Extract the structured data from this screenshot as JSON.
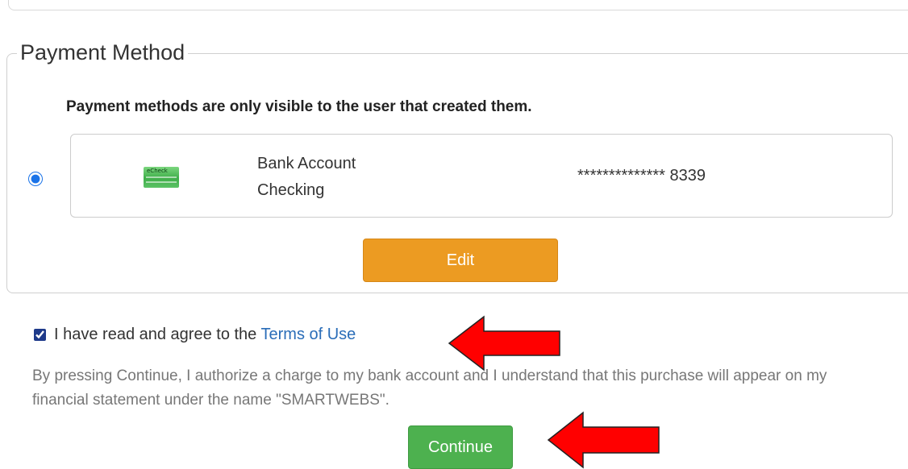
{
  "payment_method": {
    "legend": "Payment Method",
    "notice": "Payment methods are only visible to the user that created them.",
    "selected": true,
    "card": {
      "icon": "echeck-icon",
      "icon_text": "eCheck",
      "type_line1": "Bank Account",
      "type_line2": "Checking",
      "masked_number": "************** 8339"
    },
    "edit_label": "Edit"
  },
  "agreement": {
    "checked": true,
    "text": "I have read and agree to the ",
    "link_text": "Terms of Use"
  },
  "authorization_text": "By pressing Continue, I authorize a charge to my bank account and I understand that this purchase will appear on my financial statement under the name \"SMARTWEBS\".",
  "continue_label": "Continue",
  "colors": {
    "edit_button": "#ec9b22",
    "continue_button": "#4db14f",
    "link": "#2a6db8",
    "annotation_arrow": "#ff0000"
  },
  "annotations": [
    "red-arrow-icon",
    "red-arrow-icon"
  ]
}
